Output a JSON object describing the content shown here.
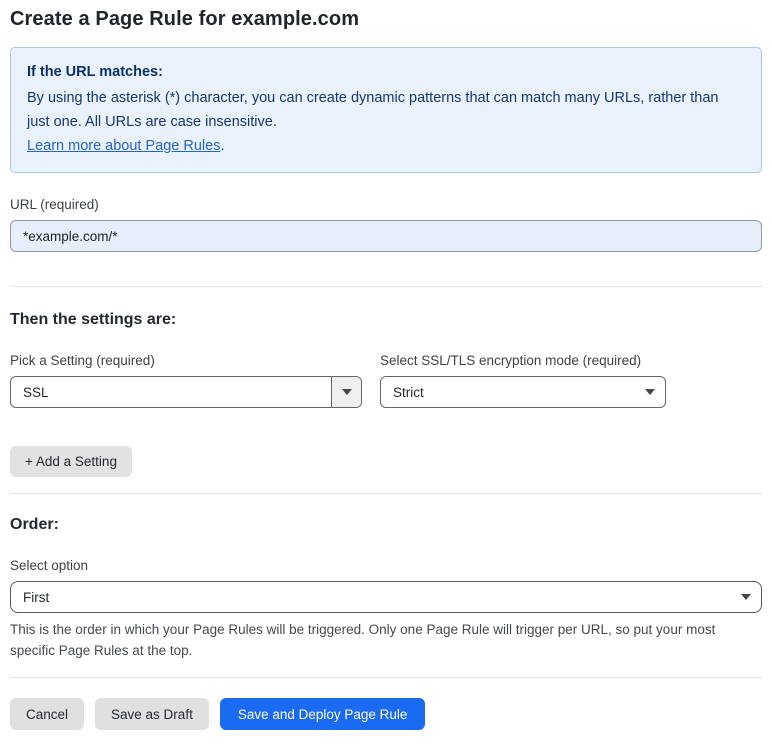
{
  "page": {
    "title": "Create a Page Rule for example.com"
  },
  "info_box": {
    "heading": "If the URL matches:",
    "body": "By using the asterisk (*) character, you can create dynamic patterns that can match many URLs, rather than just one. All URLs are case insensitive.",
    "link_label": "Learn more about Page Rules",
    "link_suffix": "."
  },
  "url_field": {
    "label": "URL (required)",
    "value": "*example.com/*"
  },
  "settings_section": {
    "heading": "Then the settings are:",
    "setting_select": {
      "label": "Pick a Setting (required)",
      "value": "SSL"
    },
    "mode_select": {
      "label": "Select SSL/TLS encryption mode (required)",
      "value": "Strict"
    },
    "add_setting_label": "+ Add a Setting"
  },
  "order_section": {
    "heading": "Order:",
    "select_label": "Select option",
    "select_value": "First",
    "helper_text": "This is the order in which your Page Rules will be triggered. Only one Page Rule will trigger per URL, so put your most specific Page Rules at the top."
  },
  "footer": {
    "cancel_label": "Cancel",
    "save_draft_label": "Save as Draft",
    "save_deploy_label": "Save and Deploy Page Rule"
  },
  "colors": {
    "primary_blue": "#1a6af2",
    "info_bg": "#e9f2fc",
    "info_border": "#a9c9ea",
    "info_text": "#16366b",
    "link_blue": "#2563c4",
    "url_input_bg": "#e7eefb",
    "neutral_button_bg": "#e0e0e0"
  }
}
